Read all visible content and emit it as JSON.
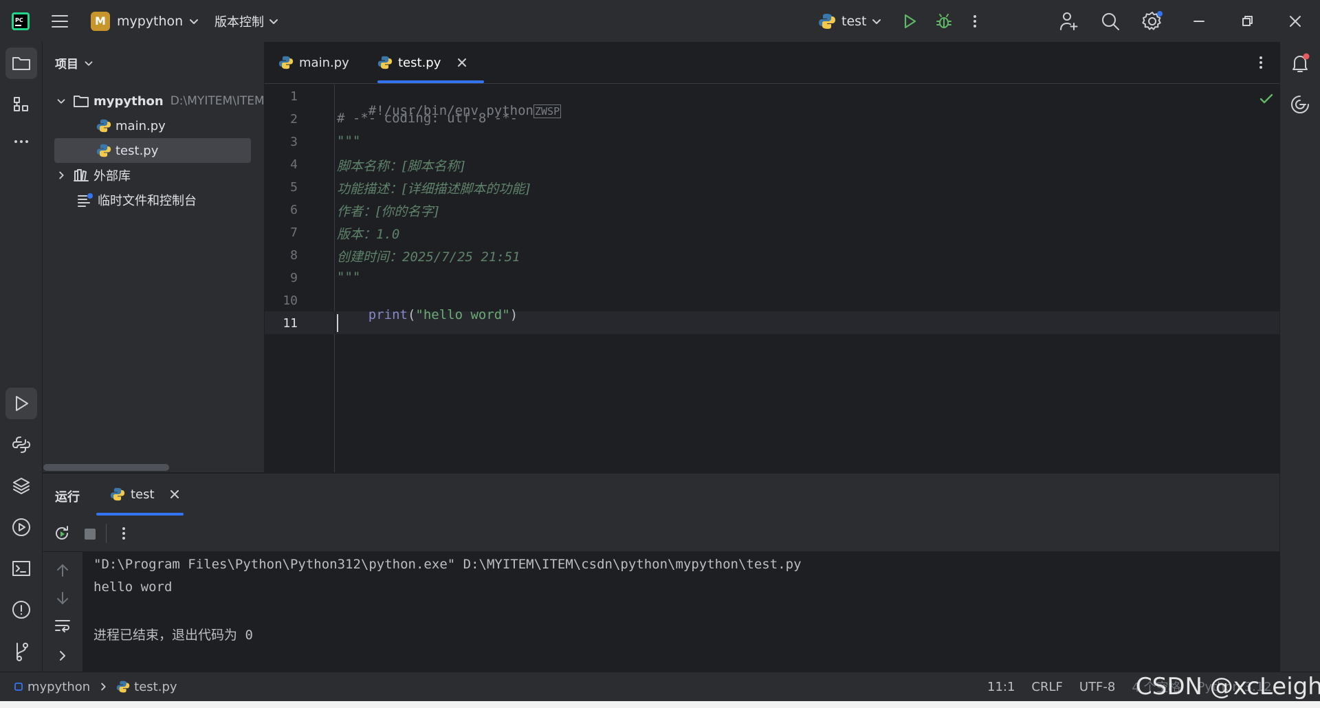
{
  "titlebar": {
    "project_badge": "M",
    "project_name": "mypython",
    "vcs_label": "版本控制",
    "run_config": "test"
  },
  "project_panel": {
    "title": "项目",
    "root_name": "mypython",
    "root_path": "D:\\MYITEM\\ITEM",
    "files": [
      "main.py",
      "test.py"
    ],
    "external_libs": "外部库",
    "scratches": "临时文件和控制台"
  },
  "editor": {
    "tabs": [
      {
        "label": "main.py"
      },
      {
        "label": "test.py"
      }
    ],
    "line_numbers": [
      "1",
      "2",
      "3",
      "4",
      "5",
      "6",
      "7",
      "8",
      "9",
      "10",
      "11"
    ],
    "lines": {
      "l1": "#!/usr/bin/env python",
      "l1_zwsp": "ZWSP",
      "l2": "# -*- coding: utf-8 -*-",
      "l3": "\"\"\"",
      "l4": "脚本名称：[脚本名称]",
      "l5": "功能描述：[详细描述脚本的功能]",
      "l6": "作者：[你的名字]",
      "l7": "版本：1.0",
      "l8": "创建时间：2025/7/25 21:51",
      "l9": "\"\"\"",
      "l10_fn": "print",
      "l10_open": "(",
      "l10_str": "\"hello word\"",
      "l10_close": ")"
    }
  },
  "run_panel": {
    "title": "运行",
    "tab": "test",
    "output": [
      "\"D:\\Program Files\\Python\\Python312\\python.exe\" D:\\MYITEM\\ITEM\\csdn\\python\\mypython\\test.py",
      "hello word",
      "",
      "进程已结束，退出代码为 0"
    ]
  },
  "statusbar": {
    "breadcrumb_project": "mypython",
    "breadcrumb_file": "test.py",
    "position": "11:1",
    "line_sep": "CRLF",
    "encoding": "UTF-8",
    "indent": "4 个空格",
    "interpreter": "Python 3.12",
    "watermark": "CSDN @xcLeigh"
  },
  "colors": {
    "accent": "#3574f0",
    "keyword_comment": "#7a7e85",
    "docstring": "#5f826b",
    "string": "#6aab73",
    "builtin": "#8888c6",
    "run_green": "#5fb865"
  }
}
